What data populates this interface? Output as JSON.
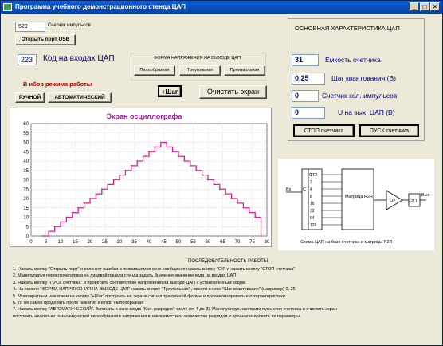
{
  "window": {
    "title": "Программа учебного демонстрационного стенда ЦАП"
  },
  "port": {
    "counter_value": "529",
    "counter_label": "Счетчик импульсов",
    "open_button": "Открыть порт USB"
  },
  "code_input": {
    "value": "223",
    "label": "Код на входах ЦАП"
  },
  "waveform": {
    "title": "ФОРМА НАПРЯЖЕНИЯ НА  ВЫХОДЕ ЦАП",
    "sawtooth": "Пилообразная",
    "triangle": "Треугольная",
    "arbitrary": "Произвольная"
  },
  "mode": {
    "title": "В ибор режима работы",
    "manual": "РУЧНОЙ",
    "auto": "АВТОМАТИЧЕСКИЙ"
  },
  "step_button": "+Шаг",
  "clear_button": "Очистить экран",
  "characteristics": {
    "title": "ОСНОВНАЯ ХАРАКТЕРИСТИКА ЦАП",
    "capacity_value": "31",
    "capacity_label": "Емкость счетчика",
    "step_value": "0,25",
    "step_label": "Шаг квантования (В)",
    "pulses_value": "0",
    "pulses_label": "Счетчик кол. импульсов",
    "uout_value": "0",
    "uout_label": "U на вых. ЦАП (В)",
    "stop_button": "СТОП счетчика",
    "start_button": "ПУСК счетчика"
  },
  "diagram": {
    "ct2": "CT2",
    "c_label": "C",
    "input_label": "Вх",
    "bits": [
      "1",
      "2",
      "4",
      "8",
      "16",
      "32",
      "64",
      "128"
    ],
    "matrix": "Матрица R2R",
    "opamp": "ОУ",
    "ep": "ЭП",
    "output_label": "Вых",
    "caption": "Схема ЦАП на базе счетчика и матрицы R2R"
  },
  "chart_data": {
    "type": "line",
    "title": "Экран осциллографа",
    "xlim": [
      0,
      80
    ],
    "ylim": [
      0,
      60
    ],
    "x_ticks": [
      "0",
      "5",
      "10",
      "15",
      "20",
      "25",
      "30",
      "35",
      "40",
      "45",
      "50",
      "55",
      "60",
      "65",
      "70",
      "75",
      "80"
    ],
    "y_ticks": [
      "0",
      "5",
      "10",
      "15",
      "20",
      "25",
      "30",
      "35",
      "40",
      "45",
      "50",
      "55",
      "60"
    ],
    "grid": true,
    "color": "#e0208f",
    "series": [
      {
        "x": [
          4,
          6,
          8,
          10,
          12,
          14,
          16,
          18,
          20,
          22,
          24,
          26,
          28,
          30,
          32,
          34,
          36,
          38,
          40,
          42,
          44,
          46,
          48,
          50,
          52,
          54,
          56,
          58,
          60,
          62,
          64,
          66,
          68,
          70,
          72,
          74,
          76,
          78
        ],
        "y": [
          0,
          2.5,
          5,
          7.5,
          10,
          12.5,
          15,
          17.5,
          20,
          22.5,
          25,
          27.5,
          30,
          32.5,
          35,
          37.5,
          40,
          42.5,
          45,
          47.5,
          50,
          47.5,
          45,
          42.5,
          40,
          37.5,
          35,
          32.5,
          30,
          27.5,
          25,
          22.5,
          20,
          17.5,
          15,
          12.5,
          10,
          7.5
        ]
      }
    ]
  },
  "instructions": {
    "title": "ПОСЛЕДОВАТЕЛЬНОСТЬ РАБОТЫ",
    "lines": [
      "1. Нажать кнопку \"Открыть порт\" и если нет ошибки в появившемся  окне сообщения нажать кнопку \"ОК\" и нажать кнопку \"СТОП счетчика\"",
      "2. Манипулируя переключателями на лицевой панели стенда задать Значение значение кода на входах ЦАП",
      "3. Нажать кнопку \"ПУСК счетчика\" и проверить соответствие напряжения на выходе ЦАП с установленным кодом.",
      "4. На панели \"ФОРМА НАПРЯЖЕНИЯ НА ВЫХОДЕ ЦАП\" нажать кнопку \"Треугольная\" , ввести в окно \"Шаг квантования\" (например) 0, 25",
      "5. Многократным нажатием на кнопку \"+Шаг\" построить на экране сигнал трегольной формы и проанализировать его характеристики",
      "6. То же самое проделать после нажатия кнопки \"Пилообразная",
      "7. Нажать кнопку \"АВТОМАТИЧЕСКИЙ\". Записать в окно ввода \"Кол. разрядов\" число (от  4 до 8). Манипулируя, кнопками пуск, стоп счетчика и очистить экран",
      "построить несколько разновидностей пилообразного напряжения в зависимости от количества разрядов и проанализировать их параметры."
    ]
  }
}
